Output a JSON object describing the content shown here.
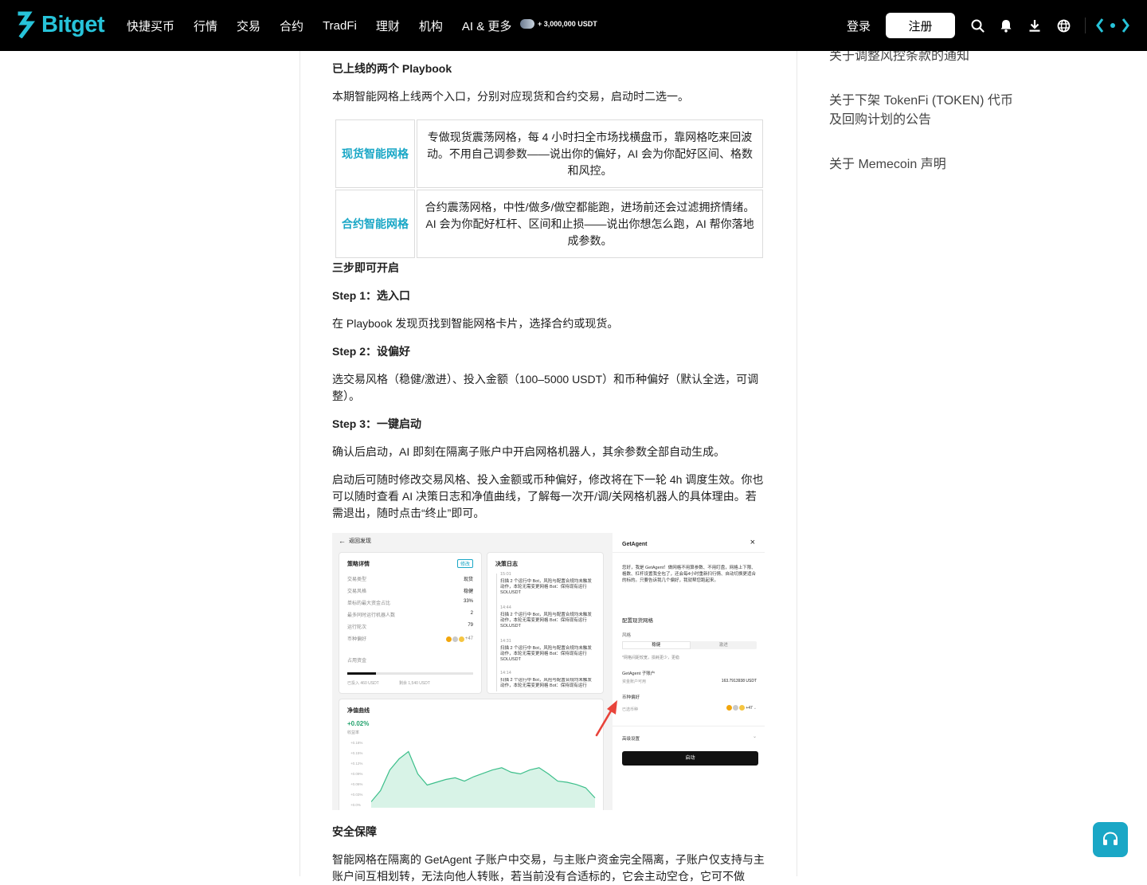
{
  "header": {
    "logo_text": "Bitget",
    "nav": [
      "快捷买币",
      "行情",
      "交易",
      "合约",
      "TradFi",
      "理财",
      "机构",
      "AI & 更多"
    ],
    "promo": "+ 3,000,000 USDT",
    "login": "登录",
    "register": "注册",
    "icons": [
      "search-icon",
      "bell-icon",
      "download-icon",
      "globe-icon"
    ],
    "colors": {
      "bg": "#000000",
      "brand": "#27c3d9"
    }
  },
  "article": {
    "h_playbook": "已上线的两个 Playbook",
    "p_intro": "本期智能网格上线两个入口，分别对应现货和合约交易，启动时二选一。",
    "table": [
      {
        "name": "现货智能网格",
        "desc": "专做现货震荡网格，每 4 小时扫全市场找横盘币，靠网格吃来回波动。不用自己调参数——说出你的偏好，AI 会为你配好区间、格数和风控。"
      },
      {
        "name": "合约智能网格",
        "desc": "合约震荡网格，中性/做多/做空都能跑，进场前还会过滤拥挤情绪。AI 会为你配好杠杆、区间和止损——说出你想怎么跑，AI 帮你落地成参数。"
      }
    ],
    "h_steps": "三步即可开启",
    "step1_title": "Step 1：选入口",
    "step1_text": "在 Playbook 发现页找到智能网格卡片，选择合约或现货。",
    "step2_title": "Step 2：设偏好",
    "step2_text": "选交易风格（稳健/激进）、投入金额（100–5000 USDT）和币种偏好（默认全选，可调整）。",
    "step3_title": "Step 3：一键启动",
    "step3_text": "确认后启动，AI 即刻在隔离子账户中开启网格机器人，其余参数全部自动生成。",
    "p_after": "启动后可随时修改交易风格、投入金额或币种偏好，修改将在下一轮 4h 调度生效。你也可以随时查看 AI 决策日志和净值曲线，了解每一次开/调/关网格机器人的具体理由。若需退出，随时点击“终止”即可。",
    "h_safety": "安全保障",
    "p_safety": "智能网格在隔离的 GetAgent 子账户中交易，与主账户资金完全隔离，子账户仅支持与主账户间互相划转，无法向他人转账，若当前没有合适标的，它会主动空仓，它可不做"
  },
  "figure": {
    "back": "返回发现",
    "strategy_title": "策略详情",
    "edit": "修改",
    "rows": [
      {
        "k": "交易类型",
        "v": "现货"
      },
      {
        "k": "交易风格",
        "v": "稳健"
      },
      {
        "k": "单标的最大资金占比",
        "v": "33%"
      },
      {
        "k": "最多同时运行机器人数",
        "v": "2"
      },
      {
        "k": "运行轮次",
        "v": "79"
      },
      {
        "k": "币种偏好",
        "v": "+47"
      }
    ],
    "funds_label": "占用资金",
    "funds_in": "已投入 460 USDT",
    "funds_left": "剩余 1,540 USDT",
    "log_title": "决策日志",
    "logs": [
      {
        "t": "15:01",
        "x": "扫描 2 个运行中 Bot，风险与配置合规均未触发动作，本轮无需变更网格 Bot：保持现有运行 SOLUSDT"
      },
      {
        "t": "14:44",
        "x": "扫描 2 个运行中 Bot，风险与配置合规均未触发动作，本轮无需变更网格 Bot：保持现有运行 SOLUSDT"
      },
      {
        "t": "14:31",
        "x": "扫描 2 个运行中 Bot，风险与配置合规均未触发动作，本轮无需变更网格 Bot：保持现有运行 SOLUSDT"
      },
      {
        "t": "14:14",
        "x": "扫描 2 个运行中 Bot，风险与配置合规均未触发动作，本轮无需变更网格 Bot：保持现有运行"
      }
    ],
    "nav_title": "净值曲线",
    "nav_value": "+0.02%",
    "nav_sub": "收益率",
    "nav_ticks": [
      "+0.18%",
      "+0.15%",
      "+0.12%",
      "+0.09%",
      "+0.06%",
      "+0.03%",
      "+0.0%"
    ],
    "nav_curve": [
      0.05,
      0.25,
      0.62,
      0.82,
      0.95,
      0.55,
      0.35,
      0.4,
      0.45,
      0.48,
      0.42,
      0.5,
      0.56,
      0.62,
      0.66,
      0.58,
      0.55,
      0.62,
      0.66,
      0.55,
      0.42,
      0.4,
      0.36,
      0.3,
      0.12
    ],
    "agent_title": "GetAgent",
    "agent_intro": "您好，我是 GetAgent！做网格不用算参数、不用盯盘，网格上下限、格数、杠杆设置我全包了，还会每4小时重新扫行情、自动切换更适合的标的。只要告诉我几个偏好，我就帮您跑起来。",
    "config_title": "配置现货网格",
    "style_label": "风格",
    "style_opts": [
      "稳健",
      "激进"
    ],
    "style_note": "*网格间距较宽，损耗更少，更稳",
    "sub_acct": "GetAgent 子账户",
    "avail_label": "资金账户可用",
    "avail_value": "163.7913938 USDT",
    "coin_pref": "币种偏好",
    "selected": "已选币种",
    "selected_more": "+47",
    "advanced": "高级设置",
    "start": "启动",
    "colors": {
      "accent": "#1aa7c6",
      "curve": "#3dbf8b",
      "arrow": "#e8433a"
    }
  },
  "sidebar": {
    "links": [
      "关于调整风控条款的通知",
      "关于下架 TokenFi (TOKEN) 代币及回购计划的公告",
      "关于 Memecoin 声明"
    ]
  },
  "support": {
    "icon": "headset-icon"
  }
}
